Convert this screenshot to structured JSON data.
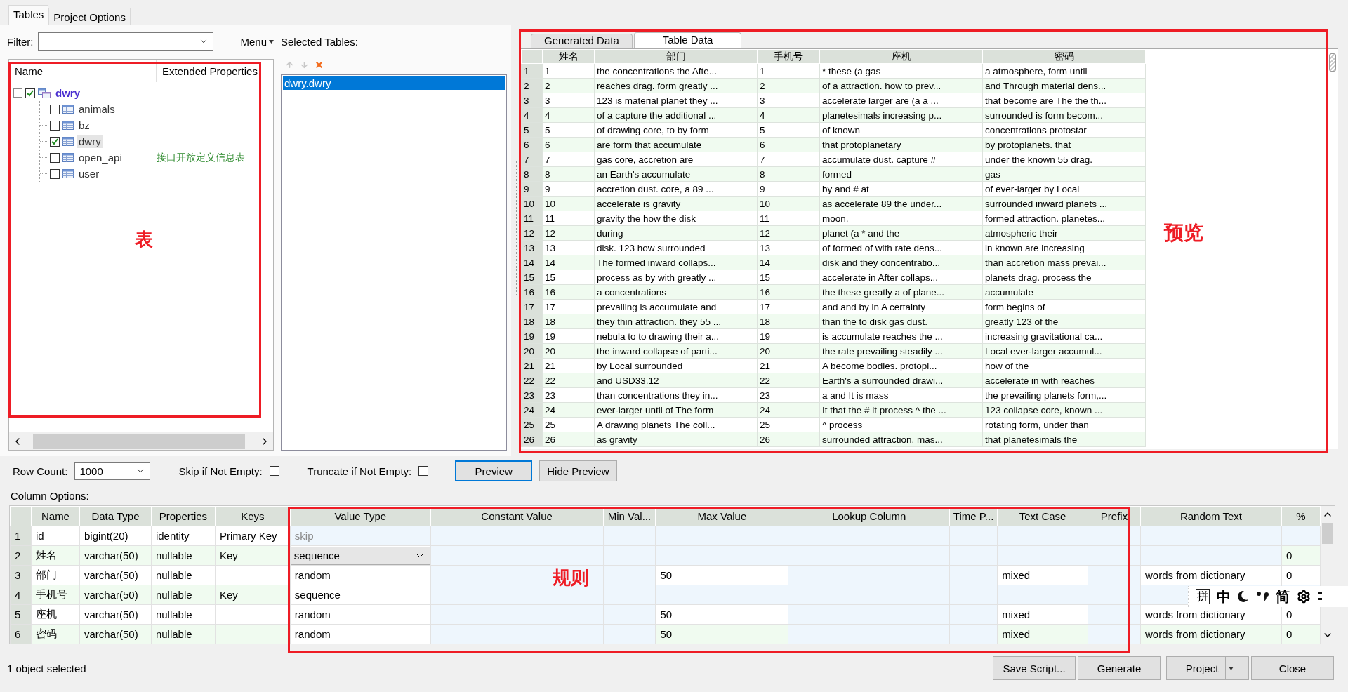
{
  "tabs": [
    {
      "label": "Tables",
      "selected": true
    },
    {
      "label": "Project Options",
      "selected": false
    }
  ],
  "filter": {
    "label": "Filter:"
  },
  "menu": {
    "label": "Menu"
  },
  "tree": {
    "columns": [
      "Name",
      "Extended Properties"
    ],
    "items": [
      {
        "name": "dwry",
        "checked": true,
        "expanded": true,
        "selected": false,
        "children": [
          {
            "name": "animals",
            "checked": false,
            "selected": false
          },
          {
            "name": "bz",
            "checked": false,
            "selected": false
          },
          {
            "name": "dwry",
            "checked": true,
            "selected": true
          },
          {
            "name": "open_api",
            "checked": false,
            "selected": false,
            "extended": "接口开放定义信息表"
          },
          {
            "name": "user",
            "checked": false,
            "selected": false
          }
        ]
      }
    ]
  },
  "selected_tables": {
    "label": "Selected Tables:",
    "items": [
      {
        "name": "dwry.dwry",
        "selected": true
      }
    ]
  },
  "preview": {
    "tabs": [
      {
        "label": "Generated Data",
        "selected": false
      },
      {
        "label": "Table Data",
        "selected": true
      }
    ],
    "columns": [
      "",
      "姓名",
      "部门",
      "手机号",
      "座机",
      "密码"
    ],
    "rows": [
      [
        "1",
        "1",
        "the concentrations the Afte...",
        "1",
        "* these (a gas",
        "a atmosphere, form until"
      ],
      [
        "2",
        "2",
        "reaches drag. form greatly ...",
        "2",
        "of a attraction. how to prev...",
        "and Through material dens..."
      ],
      [
        "3",
        "3",
        "123 is material planet they ...",
        "3",
        "accelerate larger are (a a ...",
        "that become are The the th..."
      ],
      [
        "4",
        "4",
        "of a capture the additional ...",
        "4",
        "planetesimals increasing p...",
        "surrounded is form becom..."
      ],
      [
        "5",
        "5",
        "of drawing core, to by form",
        "5",
        "of known",
        "concentrations protostar"
      ],
      [
        "6",
        "6",
        "are form that accumulate",
        "6",
        "that protoplanetary",
        "by protoplanets. that"
      ],
      [
        "7",
        "7",
        "gas core, accretion are",
        "7",
        "accumulate dust. capture #",
        "under the known 55 drag."
      ],
      [
        "8",
        "8",
        "an Earth's accumulate",
        "8",
        "formed",
        "gas"
      ],
      [
        "9",
        "9",
        "accretion dust. core, a 89 ...",
        "9",
        "by and # at",
        "of ever-larger by Local"
      ],
      [
        "10",
        "10",
        "accelerate is gravity",
        "10",
        "as accelerate 89 the under...",
        "surrounded inward planets ..."
      ],
      [
        "11",
        "11",
        "gravity the how the disk",
        "11",
        "moon,",
        "formed attraction. planetes..."
      ],
      [
        "12",
        "12",
        "during",
        "12",
        "planet (a * and the",
        "atmospheric their"
      ],
      [
        "13",
        "13",
        "disk. 123 how surrounded",
        "13",
        "of formed of with rate dens...",
        "in known are increasing"
      ],
      [
        "14",
        "14",
        "The formed inward collaps...",
        "14",
        "disk and they concentratio...",
        "than accretion mass prevai..."
      ],
      [
        "15",
        "15",
        "process as by with greatly ...",
        "15",
        "accelerate in After collaps...",
        "planets drag. process the"
      ],
      [
        "16",
        "16",
        "a concentrations",
        "16",
        "the these greatly a of plane...",
        "accumulate"
      ],
      [
        "17",
        "17",
        "prevailing is accumulate and",
        "17",
        "and and by in A certainty",
        "form begins of"
      ],
      [
        "18",
        "18",
        "they thin attraction. they 55 ...",
        "18",
        "than the to disk gas dust.",
        "greatly 123 of the"
      ],
      [
        "19",
        "19",
        "nebula to to drawing their a...",
        "19",
        "is accumulate reaches the ...",
        "increasing gravitational ca..."
      ],
      [
        "20",
        "20",
        "the inward collapse of parti...",
        "20",
        "the rate prevailing steadily ...",
        "Local ever-larger accumul..."
      ],
      [
        "21",
        "21",
        "by Local surrounded",
        "21",
        "A become bodies. protopl...",
        "how of the"
      ],
      [
        "22",
        "22",
        "and USD33.12",
        "22",
        "Earth's a surrounded drawi...",
        "accelerate in with reaches"
      ],
      [
        "23",
        "23",
        "than concentrations they in...",
        "23",
        "a and It is mass",
        "the prevailing planets form,..."
      ],
      [
        "24",
        "24",
        "ever-larger until of The form",
        "24",
        "It that the # it process ^ the ...",
        "123 collapse core, known ..."
      ],
      [
        "25",
        "25",
        "A drawing planets The coll...",
        "25",
        "^ process",
        "rotating form, under than"
      ],
      [
        "26",
        "26",
        "as gravity",
        "26",
        "surrounded attraction. mas...",
        "that planetesimals the"
      ]
    ]
  },
  "options": {
    "row_count_label": "Row Count:",
    "row_count": "1000",
    "skip_label": "Skip if Not Empty:",
    "skip_checked": false,
    "truncate_label": "Truncate if Not Empty:",
    "truncate_checked": false,
    "buttons": [
      {
        "label": "Preview",
        "focused": true
      },
      {
        "label": "Hide Preview",
        "focused": false
      }
    ]
  },
  "column_options": {
    "label": "Column Options:",
    "columns": [
      "Name",
      "Data Type",
      "Properties",
      "Keys",
      "Value Type",
      "Constant Value",
      "Min Val...",
      "Max Value",
      "Lookup Column",
      "Time P...",
      "Text Case",
      "Prefix",
      "Random Text",
      "%"
    ],
    "rows": [
      {
        "num": "1",
        "name": "id",
        "data_type": "bigint(20)",
        "properties": "identity",
        "keys": "Primary Key",
        "value_type": "skip",
        "value_greyed": true,
        "editing": false
      },
      {
        "num": "2",
        "name": "姓名",
        "data_type": "varchar(50)",
        "properties": "nullable",
        "keys": "Key",
        "value_type": "sequence",
        "percent": "0",
        "value_greyed": false,
        "editing": true
      },
      {
        "num": "3",
        "name": "部门",
        "data_type": "varchar(50)",
        "properties": "nullable",
        "value_type": "random",
        "max_value": "50",
        "text_case": "mixed",
        "random_text": "words from dictionary",
        "percent": "0",
        "value_greyed": false,
        "editing": false
      },
      {
        "num": "4",
        "name": "手机号",
        "data_type": "varchar(50)",
        "properties": "nullable",
        "keys": "Key",
        "value_type": "sequence",
        "value_greyed": false,
        "editing": false
      },
      {
        "num": "5",
        "name": "座机",
        "data_type": "varchar(50)",
        "properties": "nullable",
        "value_type": "random",
        "max_value": "50",
        "text_case": "mixed",
        "random_text": "words from dictionary",
        "percent": "0",
        "value_greyed": false,
        "editing": false
      },
      {
        "num": "6",
        "name": "密码",
        "data_type": "varchar(50)",
        "properties": "nullable",
        "value_type": "random",
        "max_value": "50",
        "text_case": "mixed",
        "random_text": "words from dictionary",
        "percent": "0",
        "value_greyed": false,
        "editing": false
      }
    ]
  },
  "status": "1 object selected",
  "footer_buttons": [
    {
      "label": "Save Script...",
      "kind": "plain"
    },
    {
      "label": "Generate",
      "kind": "plain"
    },
    {
      "label": "Project",
      "kind": "split"
    },
    {
      "label": "Close",
      "kind": "plain"
    }
  ],
  "ime_toolbar": [
    {
      "kind": "boxed",
      "label": "拼"
    },
    {
      "kind": "text",
      "label": "中"
    },
    {
      "kind": "moon"
    },
    {
      "kind": "punct"
    },
    {
      "kind": "text",
      "label": "简"
    },
    {
      "kind": "gear"
    },
    {
      "kind": "more"
    }
  ],
  "annotations": [
    {
      "label": "表"
    },
    {
      "label": "预览"
    },
    {
      "label": "规则"
    }
  ]
}
